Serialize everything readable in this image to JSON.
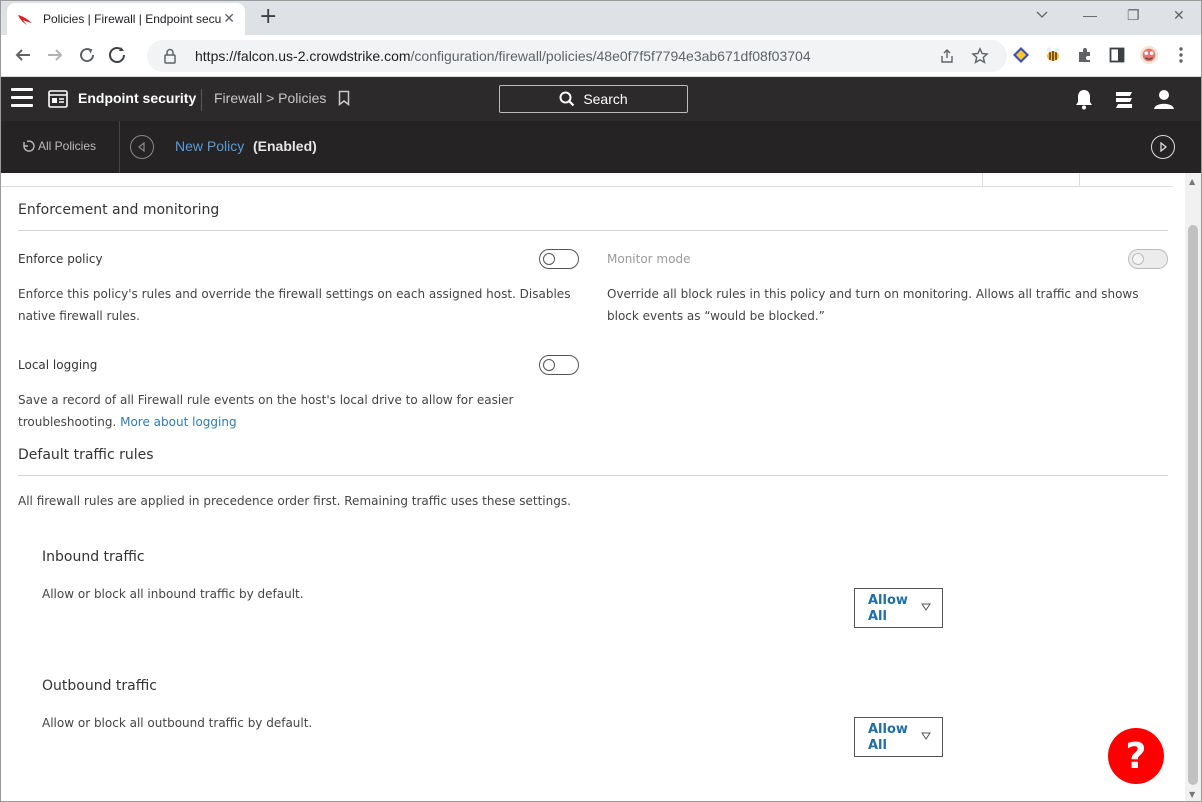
{
  "browser": {
    "tab_title": "Policies | Firewall | Endpoint secu",
    "tab_close": "✕",
    "new_tab": "+",
    "url_domain": "https://falcon.us-2.crowdstrike.com",
    "url_path": "/configuration/firewall/policies/48e0f7f5f7794e3ab671df08f03704",
    "win_minimize": "—",
    "win_restore": "❐",
    "win_close": "✕"
  },
  "header": {
    "product_name": "Endpoint security",
    "breadcrumb": "Firewall > Policies",
    "search_label": "Search"
  },
  "subheader": {
    "back_label": "All Policies",
    "policy_name": "New Policy",
    "policy_status": "(Enabled)"
  },
  "enforcement": {
    "title": "Enforcement and monitoring",
    "enforce_label": "Enforce policy",
    "enforce_desc_1": "Enforce this policy's rules and override the firewall settings on each assigned host. Disables",
    "enforce_desc_2": "native firewall rules.",
    "monitor_label": "Monitor mode",
    "monitor_desc_1": "Override all block rules in this policy and turn on monitoring. Allows all traffic and shows",
    "monitor_desc_2": "block events as “would be blocked.”",
    "logging_label": "Local logging",
    "logging_desc_1": "Save a record of all Firewall rule events on the host's local drive to allow for easier",
    "logging_desc_2": "troubleshooting.",
    "logging_link": "More about logging"
  },
  "default_rules": {
    "title": "Default traffic rules",
    "desc": "All firewall rules are applied in precedence order first. Remaining traffic uses these settings.",
    "inbound_title": "Inbound traffic",
    "inbound_desc": "Allow or block all inbound traffic by default.",
    "inbound_value": "Allow All",
    "outbound_title": "Outbound traffic",
    "outbound_desc": "Allow or block all outbound traffic by default.",
    "outbound_value": "Allow All"
  },
  "help": {
    "label": "?"
  },
  "colors": {
    "header_bg": "#2c2a2b",
    "subheader_bg": "#252324",
    "link_blue": "#2f7bb5",
    "help_red": "#ff0000"
  }
}
